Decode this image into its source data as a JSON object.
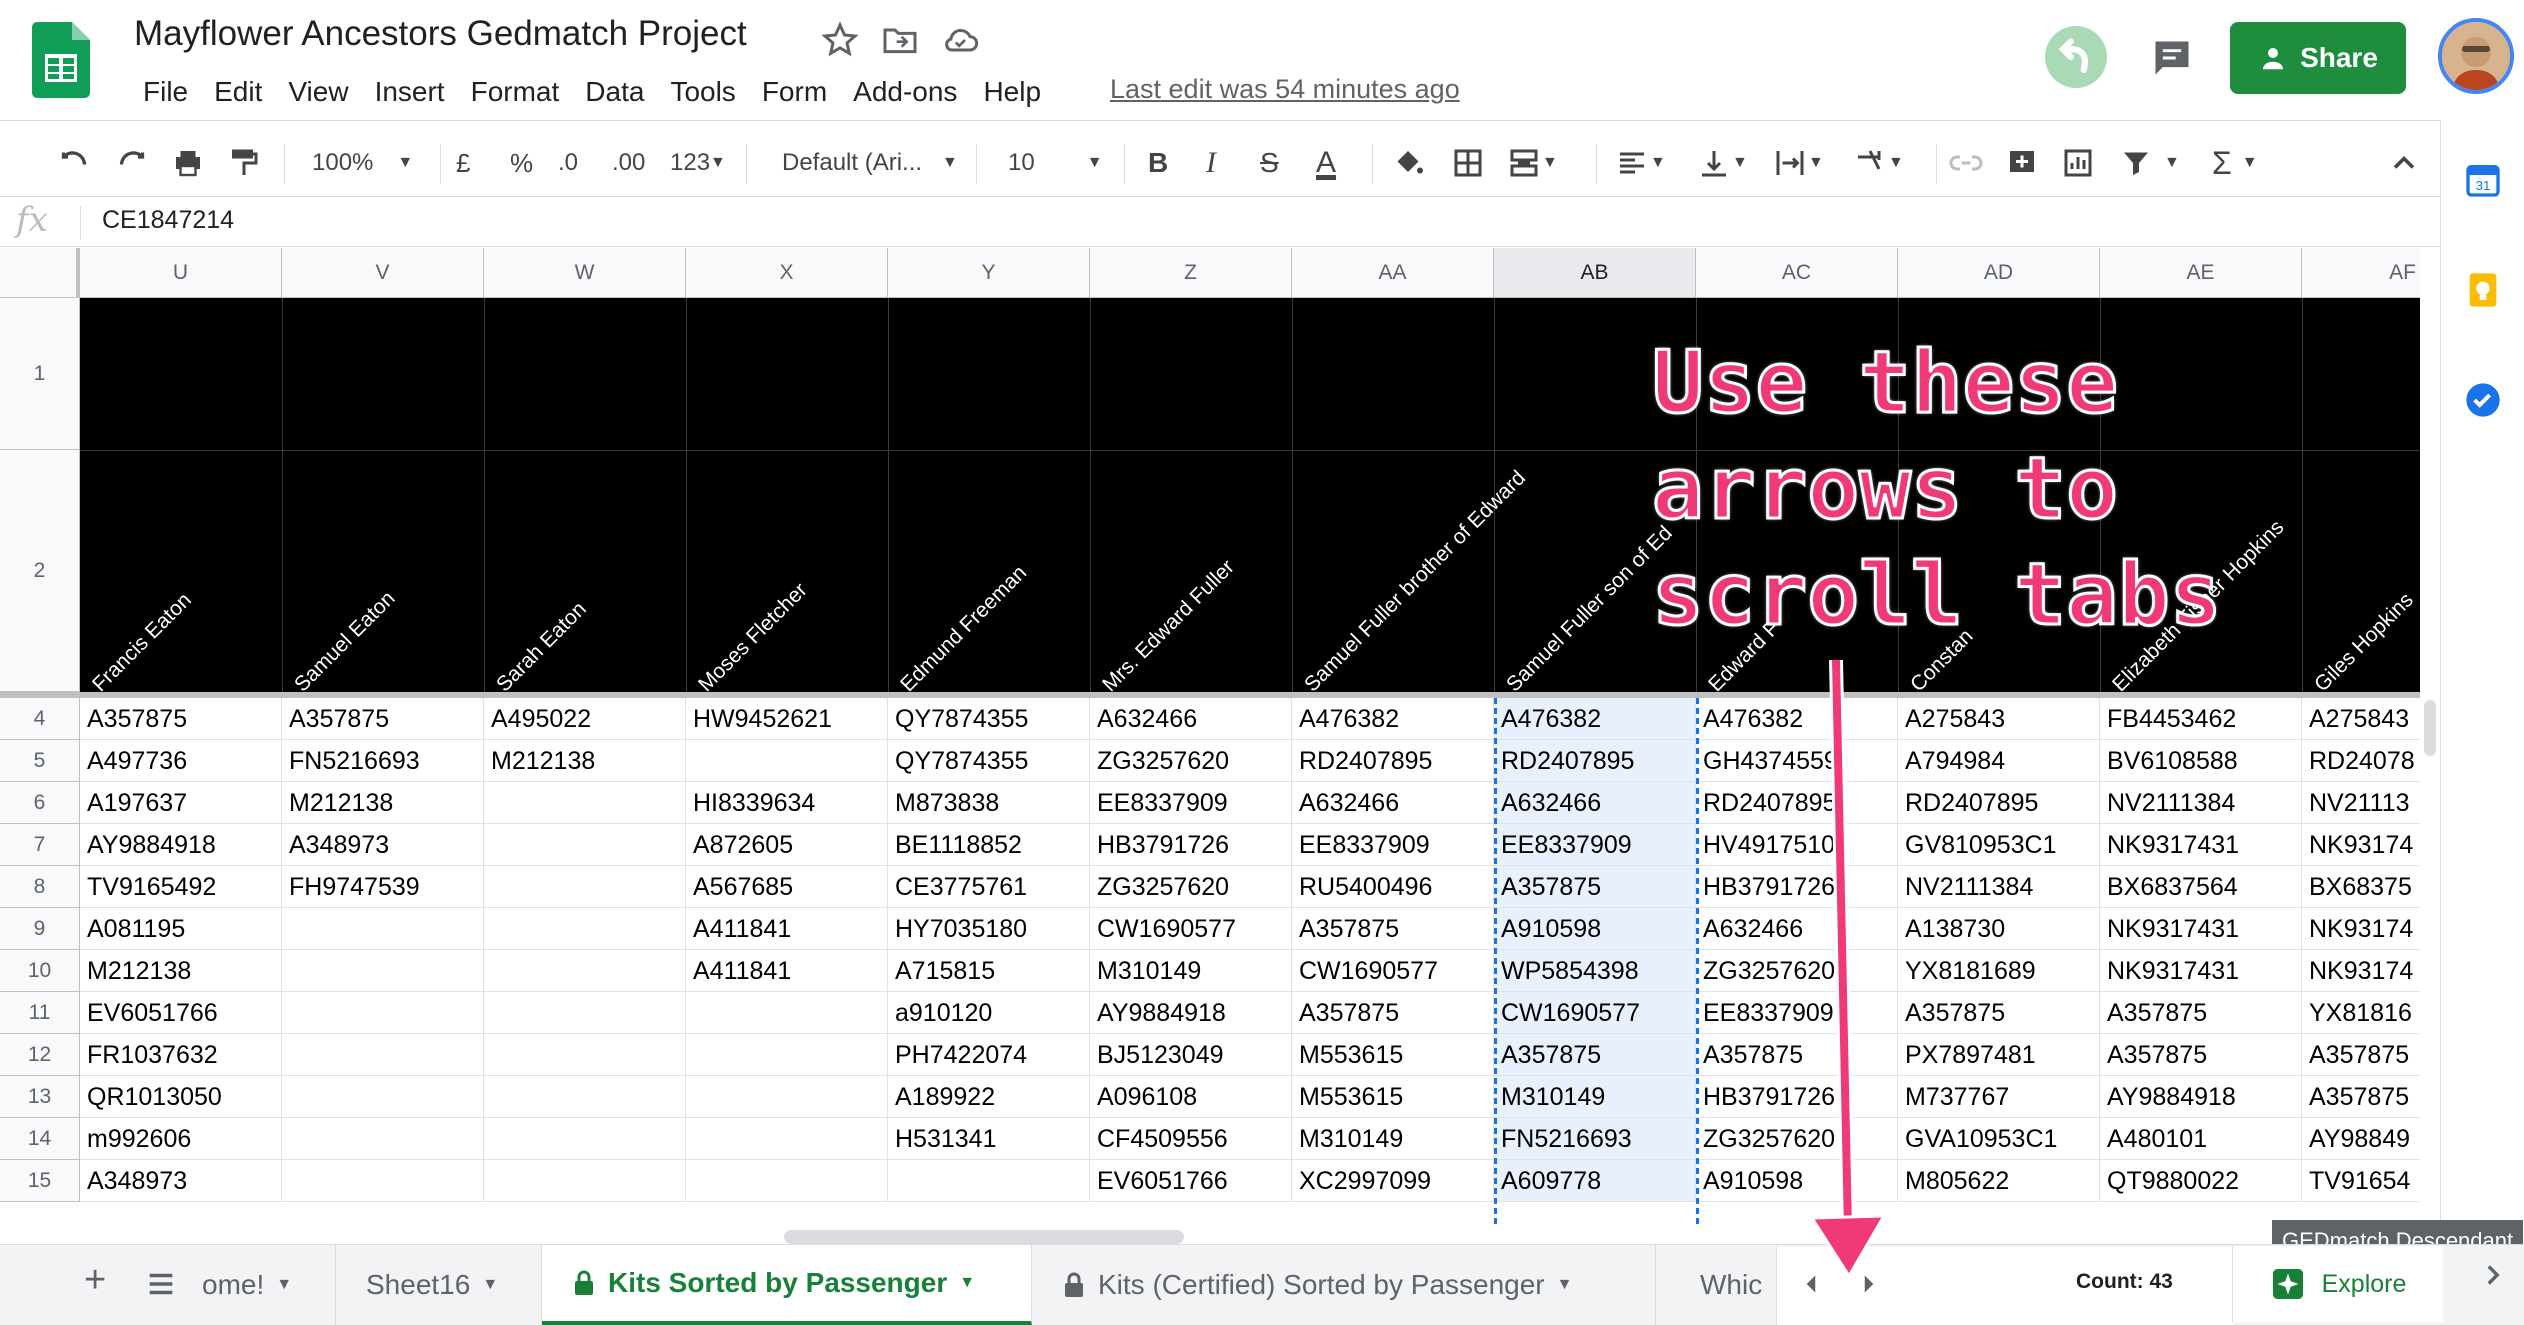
{
  "app": {
    "title": "Mayflower Ancestors Gedmatch Project",
    "last_edit": "Last edit was 54 minutes ago",
    "share_label": "Share",
    "menu": [
      "File",
      "Edit",
      "View",
      "Insert",
      "Format",
      "Data",
      "Tools",
      "Form",
      "Add-ons",
      "Help"
    ]
  },
  "toolbar": {
    "zoom": "100%",
    "currency": "£",
    "percent": "%",
    "dec_decrease": ".0",
    "dec_increase": ".00",
    "more_formats": "123",
    "font": "Default (Ari...",
    "font_size": "10",
    "bold": "B",
    "italic": "I",
    "strike": "S",
    "text_color": "A",
    "sum": "Σ"
  },
  "formula_bar": {
    "fx": "fx",
    "value": "CE1847214"
  },
  "columns": [
    "U",
    "V",
    "W",
    "X",
    "Y",
    "Z",
    "AA",
    "AB",
    "AC",
    "AD",
    "AE",
    "AF"
  ],
  "selected_column": "AB",
  "row_numbers": [
    "1",
    "2",
    "4",
    "5",
    "6",
    "7",
    "8",
    "9",
    "10",
    "11",
    "12",
    "13",
    "14",
    "15"
  ],
  "passengers": [
    "Francis Eaton",
    "Samuel Eaton",
    "Sarah Eaton",
    "Moses Fletcher",
    "Edmund Freeman",
    "Mrs. Edward Fuller",
    "Samuel Fuller brother of Edward",
    "Samuel Fuller son of Ed",
    "Edward F",
    "Constan",
    "Elizabeth Fisher Hopkins",
    "Giles Hopkins"
  ],
  "rows": [
    [
      "A357875",
      "A357875",
      "A495022",
      "HW9452621",
      "QY7874355",
      "A632466",
      "A476382",
      "A476382",
      "A476382",
      "A275843",
      "FB4453462",
      "A275843"
    ],
    [
      "A497736",
      "FN5216693",
      "M212138",
      "",
      "QY7874355",
      "ZG3257620",
      "RD2407895",
      "RD2407895",
      "GH4374559",
      "A794984",
      "BV6108588",
      "RD24078"
    ],
    [
      "A197637",
      "M212138",
      "",
      "HI8339634",
      "M873838",
      "EE8337909",
      "A632466",
      "A632466",
      "RD2407895",
      "RD2407895",
      "NV2111384",
      "NV21113"
    ],
    [
      "AY9884918",
      "A348973",
      "",
      "A872605",
      "BE1118852",
      "HB3791726",
      "EE8337909",
      "EE8337909",
      "HV4917510",
      "GV810953C1",
      "NK9317431",
      "NK93174"
    ],
    [
      "TV9165492",
      "FH9747539",
      "",
      "A567685",
      "CE3775761",
      "ZG3257620",
      "RU5400496",
      "A357875",
      "HB3791726",
      "NV2111384",
      "BX6837564",
      "BX68375"
    ],
    [
      "A081195",
      "",
      "",
      "A411841",
      "HY7035180",
      "CW1690577",
      "A357875",
      "A910598",
      "A632466",
      "A138730",
      "NK9317431",
      "NK93174"
    ],
    [
      "M212138",
      "",
      "",
      "A411841",
      "A715815",
      "M310149",
      "CW1690577",
      "WP5854398",
      "ZG3257620",
      "YX8181689",
      "NK9317431",
      "NK93174"
    ],
    [
      "EV6051766",
      "",
      "",
      "",
      "a910120",
      "AY9884918",
      "A357875",
      "CW1690577",
      "EE8337909",
      "A357875",
      "A357875",
      "YX81816"
    ],
    [
      "FR1037632",
      "",
      "",
      "",
      "PH7422074",
      "BJ5123049",
      "M553615",
      "A357875",
      "A357875",
      "PX7897481",
      "A357875",
      "A357875"
    ],
    [
      "QR1013050",
      "",
      "",
      "",
      "A189922",
      "A096108",
      "M553615",
      "M310149",
      "HB3791726",
      "M737767",
      "AY9884918",
      "A357875"
    ],
    [
      "m992606",
      "",
      "",
      "",
      "H531341",
      "CF4509556",
      "M310149",
      "FN5216693",
      "ZG3257620",
      "GVA10953C1",
      "A480101",
      "AY98849"
    ],
    [
      "A348973",
      "",
      "",
      "",
      "",
      "EV6051766",
      "XC2997099",
      "A609778",
      "A910598",
      "M805622",
      "QT9880022",
      "TV91654"
    ]
  ],
  "tabs": {
    "partial_first": "ome!",
    "sheet16": "Sheet16",
    "active": "Kits Sorted by Passenger",
    "certified": "Kits (Certified) Sorted by Passenger",
    "partial_last": "Whic"
  },
  "status": {
    "count": "Count: 43",
    "explore": "Explore",
    "tooltip": "GEDmatch Descendant"
  },
  "annotation": {
    "lines": [
      "Use these",
      "arrows to",
      "scroll tabs"
    ],
    "color": "#f03a78"
  },
  "colors": {
    "brand_green": "#188038",
    "share_green": "#1e8e3e",
    "selection_blue": "#1a73e8"
  }
}
